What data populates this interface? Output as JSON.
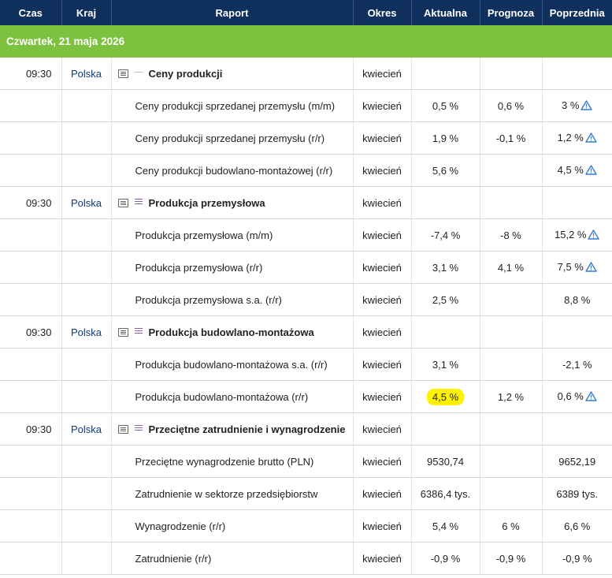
{
  "header": {
    "time": "Czas",
    "country": "Kraj",
    "report": "Raport",
    "period": "Okres",
    "actual": "Aktualna",
    "forecast": "Prognoza",
    "previous": "Poprzednia"
  },
  "date_label": "Czwartek, 21 maja 2026",
  "colors": {
    "header_bg": "#0f2f5d",
    "date_bg": "#7dc23f",
    "highlight": "#fff200",
    "importance": "#8b5bb5"
  },
  "icons": {
    "report": "document-list-icon",
    "importance": "importance-bars-icon",
    "revision": "warning-triangle-icon"
  },
  "rows": [
    {
      "time": "09:30",
      "country": "Polska",
      "report": "Ceny produkcji",
      "period": "kwiecień",
      "actual": "",
      "forecast": "",
      "previous": ""
    },
    {
      "time": "",
      "country": "",
      "report": "Ceny produkcji sprzedanej przemysłu (m/m)",
      "period": "kwiecień",
      "actual": "0,5 %",
      "forecast": "0,6 %",
      "previous": "3 %"
    },
    {
      "time": "",
      "country": "",
      "report": "Ceny produkcji sprzedanej przemysłu (r/r)",
      "period": "kwiecień",
      "actual": "1,9 %",
      "forecast": "-0,1 %",
      "previous": "1,2 %"
    },
    {
      "time": "",
      "country": "",
      "report": "Ceny produkcji budowlano-montażowej (r/r)",
      "period": "kwiecień",
      "actual": "5,6 %",
      "forecast": "",
      "previous": "4,5 %"
    },
    {
      "time": "09:30",
      "country": "Polska",
      "report": "Produkcja przemysłowa",
      "period": "kwiecień",
      "actual": "",
      "forecast": "",
      "previous": ""
    },
    {
      "time": "",
      "country": "",
      "report": "Produkcja przemysłowa (m/m)",
      "period": "kwiecień",
      "actual": "-7,4 %",
      "forecast": "-8 %",
      "previous": "15,2 %"
    },
    {
      "time": "",
      "country": "",
      "report": "Produkcja przemysłowa (r/r)",
      "period": "kwiecień",
      "actual": "3,1 %",
      "forecast": "4,1 %",
      "previous": "7,5 %"
    },
    {
      "time": "",
      "country": "",
      "report": "Produkcja przemysłowa s.a. (r/r)",
      "period": "kwiecień",
      "actual": "2,5 %",
      "forecast": "",
      "previous": "8,8 %"
    },
    {
      "time": "09:30",
      "country": "Polska",
      "report": "Produkcja budowlano-montażowa",
      "period": "kwiecień",
      "actual": "",
      "forecast": "",
      "previous": ""
    },
    {
      "time": "",
      "country": "",
      "report": "Produkcja budowlano-montażowa s.a. (r/r)",
      "period": "kwiecień",
      "actual": "3,1 %",
      "forecast": "",
      "previous": "-2,1 %"
    },
    {
      "time": "",
      "country": "",
      "report": "Produkcja budowlano-montażowa (r/r)",
      "period": "kwiecień",
      "actual": "4,5 %",
      "forecast": "1,2 %",
      "previous": "0,6 %"
    },
    {
      "time": "09:30",
      "country": "Polska",
      "report": "Przeciętne zatrudnienie i wynagrodzenie",
      "period": "kwiecień",
      "actual": "",
      "forecast": "",
      "previous": ""
    },
    {
      "time": "",
      "country": "",
      "report": "Przeciętne wynagrodzenie brutto (PLN)",
      "period": "kwiecień",
      "actual": "9530,74",
      "forecast": "",
      "previous": "9652,19"
    },
    {
      "time": "",
      "country": "",
      "report": "Zatrudnienie w sektorze przedsiębiorstw",
      "period": "kwiecień",
      "actual": "6386,4 tys.",
      "forecast": "",
      "previous": "6389 tys."
    },
    {
      "time": "",
      "country": "",
      "report": "Wynagrodzenie (r/r)",
      "period": "kwiecień",
      "actual": "5,4 %",
      "forecast": "6 %",
      "previous": "6,6 %"
    },
    {
      "time": "",
      "country": "",
      "report": "Zatrudnienie (r/r)",
      "period": "kwiecień",
      "actual": "-0,9 %",
      "forecast": "-0,9 %",
      "previous": "-0,9 %"
    }
  ]
}
